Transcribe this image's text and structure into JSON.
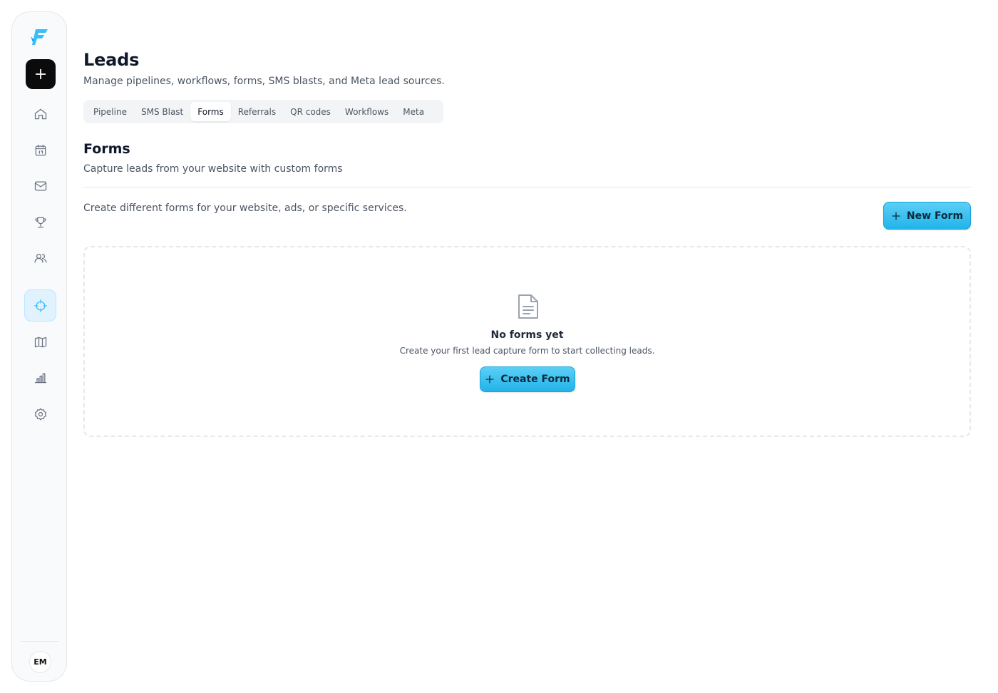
{
  "sidebar": {
    "logo_icon": "brand-f-logo",
    "add_icon": "plus-icon",
    "items": [
      {
        "name": "home",
        "icon": "home-icon",
        "active": false
      },
      {
        "name": "calendar",
        "icon": "calendar-icon",
        "active": false
      },
      {
        "name": "inbox",
        "icon": "mail-icon",
        "active": false
      },
      {
        "name": "rewards",
        "icon": "trophy-icon",
        "active": false
      },
      {
        "name": "contacts",
        "icon": "users-icon",
        "active": false
      },
      {
        "name": "leads",
        "icon": "crosshair-icon",
        "active": true
      },
      {
        "name": "map",
        "icon": "map-icon",
        "active": false
      },
      {
        "name": "reports",
        "icon": "bar-chart-icon",
        "active": false
      },
      {
        "name": "settings",
        "icon": "gear-icon",
        "active": false
      }
    ],
    "avatar_initials": "EM"
  },
  "header": {
    "title": "Leads",
    "subtitle": "Manage pipelines, workflows, forms, SMS blasts, and Meta lead sources."
  },
  "tabs": [
    {
      "label": "Pipeline",
      "active": false
    },
    {
      "label": "SMS Blast",
      "active": false
    },
    {
      "label": "Forms",
      "active": true
    },
    {
      "label": "Referrals",
      "active": false
    },
    {
      "label": "QR codes",
      "active": false
    },
    {
      "label": "Workflows",
      "active": false
    },
    {
      "label": "Meta",
      "active": false
    }
  ],
  "forms": {
    "title": "Forms",
    "subtitle": "Capture leads from your website with custom forms",
    "description": "Create different forms for your website, ads, or specific services.",
    "new_form_label": "New Form",
    "empty": {
      "icon": "document-icon",
      "title": "No forms yet",
      "text": "Create your first lead capture form to start collecting leads.",
      "button_label": "Create Form"
    }
  },
  "colors": {
    "accent": "#38bdf8",
    "button_gradient_top": "#5ccff5",
    "button_gradient_bottom": "#22b3ea",
    "active_nav_bg": "#e0f2fe"
  }
}
